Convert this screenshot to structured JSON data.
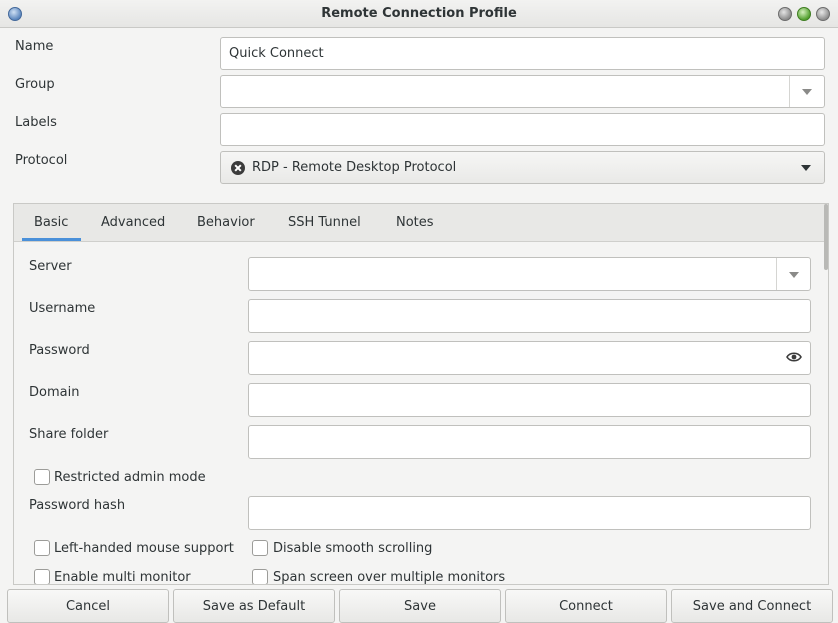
{
  "window": {
    "title": "Remote Connection Profile"
  },
  "profile": {
    "name_label": "Name",
    "name_value": "Quick Connect",
    "group_label": "Group",
    "group_value": "",
    "labels_label": "Labels",
    "labels_value": "",
    "protocol_label": "Protocol",
    "protocol_value": "RDP - Remote Desktop Protocol"
  },
  "tabs": [
    {
      "label": "Basic",
      "selected": true
    },
    {
      "label": "Advanced",
      "selected": false
    },
    {
      "label": "Behavior",
      "selected": false
    },
    {
      "label": "SSH Tunnel",
      "selected": false
    },
    {
      "label": "Notes",
      "selected": false
    }
  ],
  "basic": {
    "server_label": "Server",
    "server_value": "",
    "username_label": "Username",
    "username_value": "",
    "password_label": "Password",
    "password_value": "",
    "domain_label": "Domain",
    "domain_value": "",
    "share_folder_label": "Share folder",
    "share_folder_value": "",
    "restricted_admin_label": "Restricted admin mode",
    "restricted_admin_checked": false,
    "password_hash_label": "Password hash",
    "password_hash_value": "",
    "left_handed_label": "Left-handed mouse support",
    "left_handed_checked": false,
    "disable_smooth_label": "Disable smooth scrolling",
    "disable_smooth_checked": false,
    "multi_monitor_label": "Enable multi monitor",
    "multi_monitor_checked": false,
    "span_screen_label": "Span screen over multiple monitors",
    "span_screen_checked": false
  },
  "buttons": {
    "cancel": "Cancel",
    "save_default": "Save as Default",
    "save": "Save",
    "connect": "Connect",
    "save_connect": "Save and Connect"
  },
  "icons": {
    "protocol": "rdp-icon",
    "dropdown": "chevron-down-icon",
    "reveal_password": "eye-icon"
  },
  "colors": {
    "accent": "#4a90d9"
  }
}
